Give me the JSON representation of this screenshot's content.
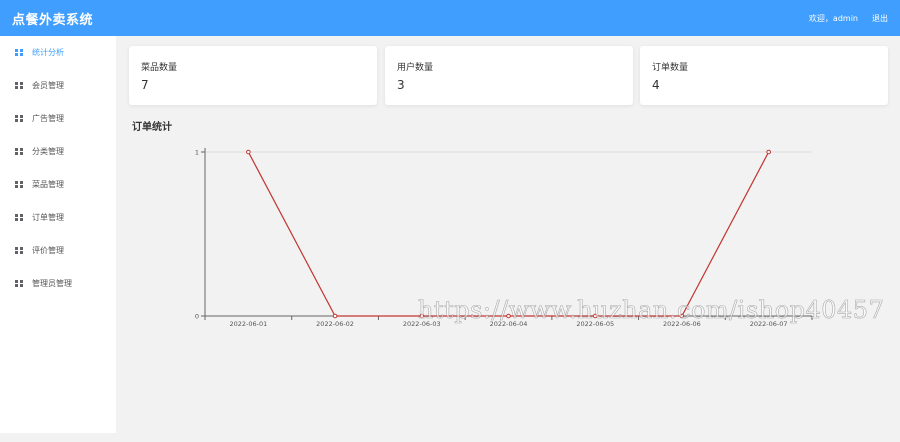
{
  "header": {
    "title": "点餐外卖系统",
    "welcome": "欢迎，admin",
    "logout": "退出"
  },
  "sidebar": {
    "items": [
      {
        "label": "统计分析",
        "icon": "grid-icon",
        "active": true
      },
      {
        "label": "会员管理",
        "icon": "grid-icon"
      },
      {
        "label": "广告管理",
        "icon": "grid-icon"
      },
      {
        "label": "分类管理",
        "icon": "grid-icon"
      },
      {
        "label": "菜品管理",
        "icon": "grid-icon"
      },
      {
        "label": "订单管理",
        "icon": "grid-icon"
      },
      {
        "label": "评价管理",
        "icon": "grid-icon"
      },
      {
        "label": "管理员管理",
        "icon": "grid-icon"
      }
    ]
  },
  "cards": [
    {
      "label": "菜品数量",
      "value": "7"
    },
    {
      "label": "用户数量",
      "value": "3"
    },
    {
      "label": "订单数量",
      "value": "4"
    }
  ],
  "section_title": "订单统计",
  "watermark": "https://www.huzhan.com/ishop40457",
  "colors": {
    "header": "#409eff",
    "active": "#409eff",
    "line": "#c23531"
  },
  "chart_data": {
    "type": "line",
    "categories": [
      "2022-06-01",
      "2022-06-02",
      "2022-06-03",
      "2022-06-04",
      "2022-06-05",
      "2022-06-06",
      "2022-06-07"
    ],
    "series": [
      {
        "values": [
          1,
          0,
          0,
          0,
          0,
          0,
          1
        ]
      }
    ],
    "yticks": [
      "0",
      "1"
    ],
    "ylim": [
      0,
      1
    ],
    "grid": true
  }
}
